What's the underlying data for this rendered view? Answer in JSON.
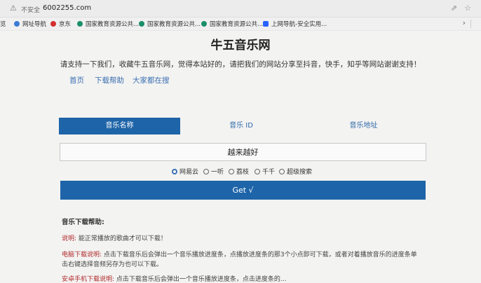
{
  "browser": {
    "security_label": "不安全",
    "url": "6002255.com",
    "bookmarks": [
      {
        "label": "网址导航",
        "color": "#3a7bd5"
      },
      {
        "label": "京东",
        "color": "#d32f2f"
      },
      {
        "label": "国家教育资源公共...",
        "color": "#1a8f6a"
      },
      {
        "label": "国家教育资源公共...",
        "color": "#1a8f6a"
      },
      {
        "label": "国家教育资源公共...",
        "color": "#1a8f6a"
      },
      {
        "label": "上网导航-安全实用...",
        "color": "#2962ff"
      }
    ],
    "left_cut_label": "览"
  },
  "page": {
    "title": "牛五音乐网",
    "subtitle": "请支持一下我们，收藏牛五音乐网，觉得本站好的，请把我们的网站分享至抖音，快手，知乎等网站谢谢支持！",
    "nav": [
      "首页",
      "下载帮助",
      "大家都在搜"
    ],
    "tabs": [
      "音乐名称",
      "音乐 ID",
      "音乐地址"
    ],
    "active_tab": 0,
    "search_value": "越来越好",
    "sources": [
      "网易云",
      "一听",
      "荔枝",
      "千千",
      "超级搜索"
    ],
    "selected_source": 0,
    "get_button": "Get √",
    "help_title": "音乐下载帮助:",
    "help_lines": [
      {
        "label": "说明:",
        "text": "能正常播放的歌曲才可以下载！"
      },
      {
        "label": "电脑下载说明:",
        "text": "点击下载音乐后会弹出一个音乐播放进度条，点播放进度条的那3个小点即可下载，或者对着播放音乐的进度条单"
      },
      {
        "label": "",
        "text": "击右键选择音频另存为也可以下载。"
      },
      {
        "label": "安卓手机下载说明:",
        "text": "点击下载音乐后会弹出一个音乐播放进度条，点击进度条的..."
      }
    ]
  }
}
